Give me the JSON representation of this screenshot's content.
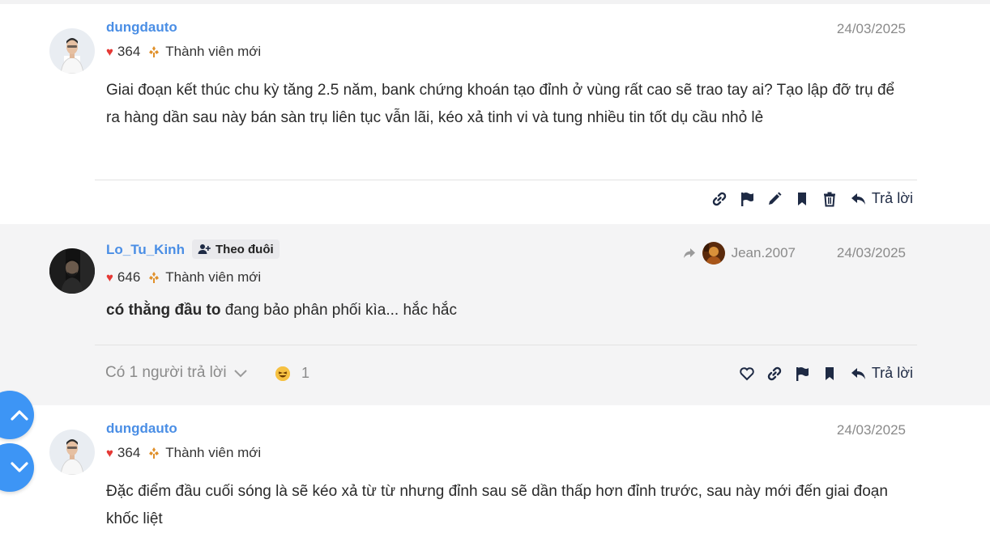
{
  "posts": [
    {
      "author": "dungdauto",
      "likes": "364",
      "rank": "Thành viên mới",
      "date": "24/03/2025",
      "body": "Giai đoạn kết thúc chu kỳ tăng 2.5 năm, bank chứng khoán tạo đỉnh ở vùng rất cao sẽ trao tay ai? Tạo lập đỡ trụ để ra hàng dần sau này bán sàn trụ liên tục vẫn lãi, kéo xả tinh vi và tung nhiều tin tốt dụ cầu nhỏ lẻ",
      "reply_label": "Trả lời"
    },
    {
      "author": "Lo_Tu_Kinh",
      "follow_label": "Theo đuôi",
      "likes": "646",
      "rank": "Thành viên mới",
      "quoted_user": "Jean.2007",
      "date": "24/03/2025",
      "body_bold": "có thằng đầu to",
      "body_rest": " đang bảo phân phối kìa... hắc hắc",
      "replies_count_label": "Có 1 người trả lời",
      "reaction_count": "1",
      "reply_label": "Trả lời"
    },
    {
      "author": "dungdauto",
      "likes": "364",
      "rank": "Thành viên mới",
      "date": "24/03/2025",
      "body": "Đặc điểm đầu cuối sóng là sẽ kéo xả từ từ nhưng đỉnh sau sẽ dần thấp hơn đỉnh trước, sau này mới đến giai đoạn khốc liệt"
    }
  ],
  "colors": {
    "author": "#4a8ee5",
    "heart": "#e53935",
    "rank_icon": "#e0902a",
    "scroll_button": "#3d95f5",
    "action_icon": "#1e2a44"
  },
  "icons": [
    "link-icon",
    "flag-icon",
    "pencil-icon",
    "bookmark-icon",
    "trash-icon",
    "reply-icon",
    "heart-outline-icon",
    "share-icon",
    "chevron-down-icon",
    "chevron-up-icon",
    "follow-user-icon",
    "laugh-emoji-icon"
  ]
}
